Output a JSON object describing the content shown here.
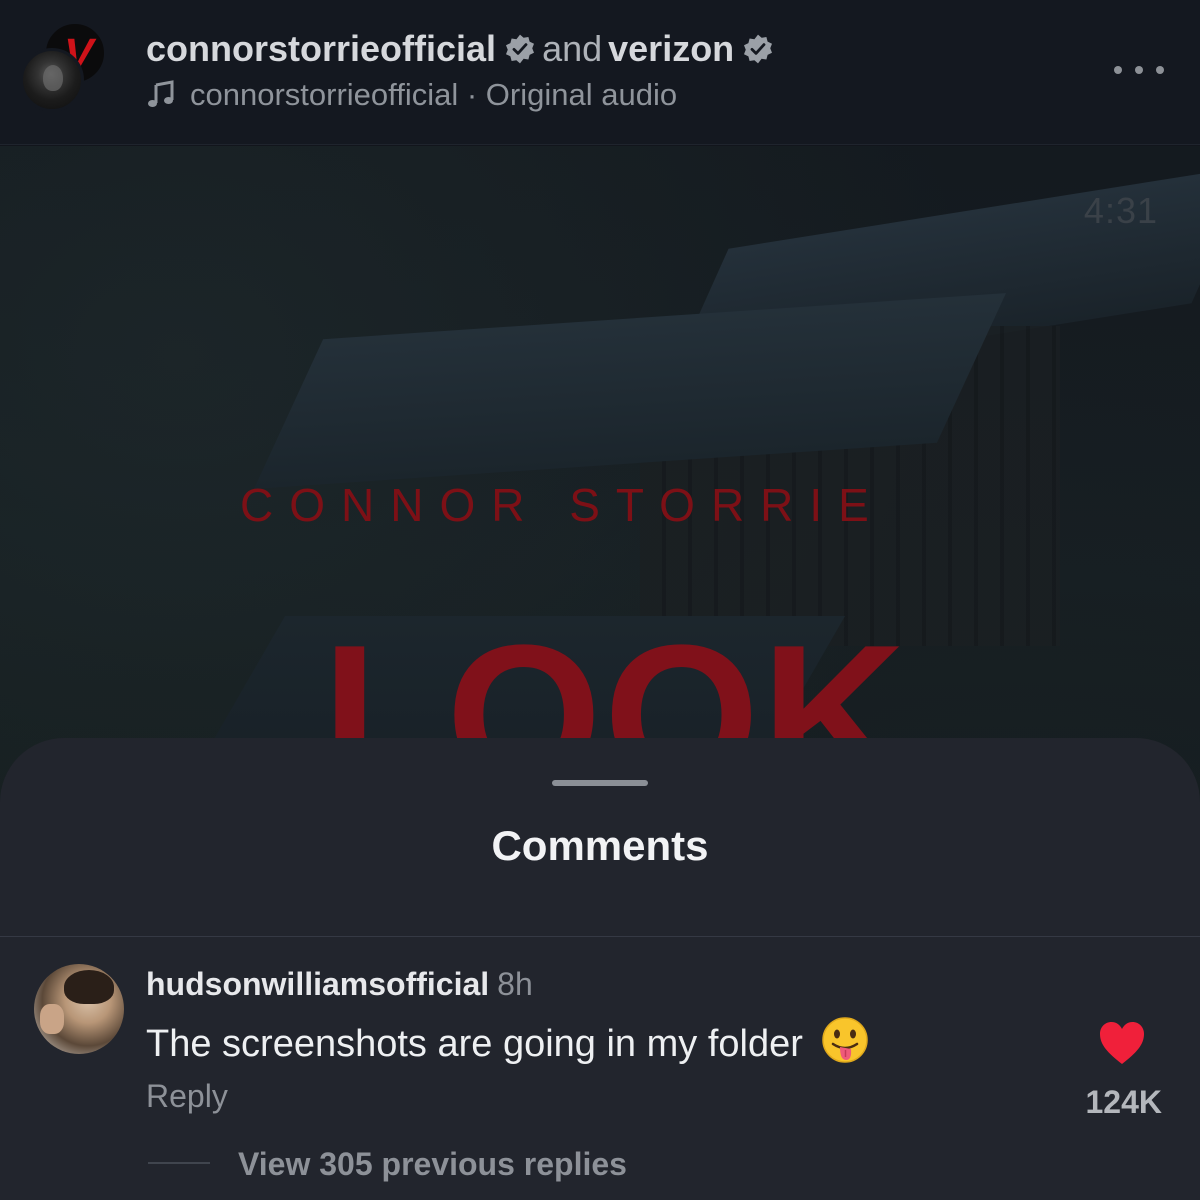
{
  "header": {
    "creator": "connorstorrieofficial",
    "conjunction": "and",
    "collaborator": "verizon",
    "audio_artist": "connorstorrieofficial",
    "audio_separator": " · ",
    "audio_title": "Original audio",
    "brand_color": "#cf1219"
  },
  "video": {
    "timestamp": "4:31",
    "artist_text": "CONNOR STORRIE",
    "title_text": "LOOK",
    "accent_color": "#80111a"
  },
  "comments_sheet": {
    "title": "Comments",
    "comment": {
      "username": "hudsonwilliamsofficial",
      "time": "8h",
      "text": "The screenshots are going in my folder",
      "emoji": "face-with-tongue",
      "reply_label": "Reply",
      "like_count": "124K",
      "liked": true,
      "like_color": "#f0203a",
      "view_replies_label": "View 305 previous replies"
    }
  }
}
